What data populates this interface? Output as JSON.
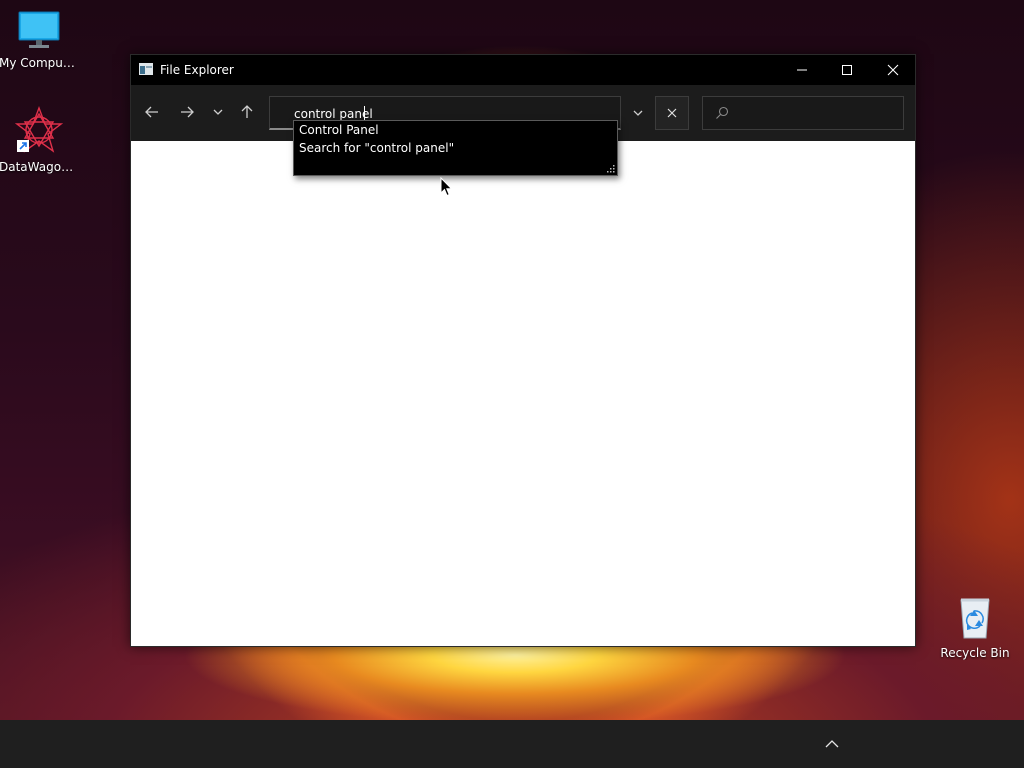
{
  "desktop": {
    "icons": [
      {
        "label": "My Computer",
        "icon": "monitor-icon"
      },
      {
        "label": "DataWagon...",
        "icon": "datawagon-icon"
      },
      {
        "label": "Recycle Bin",
        "icon": "recycle-bin-icon"
      }
    ]
  },
  "window": {
    "title": "File Explorer",
    "controls": {
      "minimize": "minimize-icon",
      "maximize": "maximize-icon",
      "close": "close-icon"
    }
  },
  "toolbar": {
    "address_value": "control panel",
    "search_placeholder": ""
  },
  "suggestions": [
    "Control Panel",
    "Search for \"control panel\""
  ],
  "colors": {
    "titlebar": "#000000",
    "toolbar": "#1c1c1c",
    "content": "#ffffff",
    "taskbar": "#1f1f1f"
  }
}
